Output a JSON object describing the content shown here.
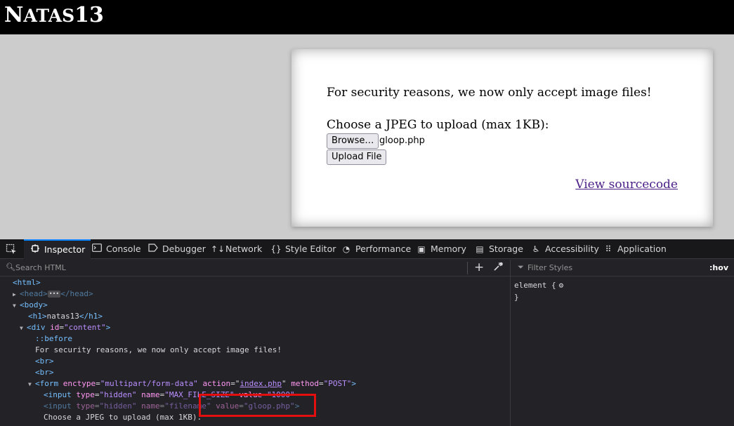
{
  "header": {
    "title_first": "N",
    "title_small": "ATAS",
    "title_number": "13"
  },
  "card": {
    "notice": "For security reasons, we now only accept image files!",
    "choose_label": "Choose a JPEG to upload (max 1KB):",
    "browse_button": "Browse…",
    "selected_file": "gloop.php",
    "upload_button": "Upload File",
    "source_link": "View sourcecode"
  },
  "devtools": {
    "tabs": [
      {
        "label": "Inspector",
        "icon": "inspector-icon"
      },
      {
        "label": "Console",
        "icon": "console-icon"
      },
      {
        "label": "Debugger",
        "icon": "debugger-icon"
      },
      {
        "label": "Network",
        "icon": "network-icon"
      },
      {
        "label": "Style Editor",
        "icon": "style-editor-icon"
      },
      {
        "label": "Performance",
        "icon": "performance-icon"
      },
      {
        "label": "Memory",
        "icon": "memory-icon"
      },
      {
        "label": "Storage",
        "icon": "storage-icon"
      },
      {
        "label": "Accessibility",
        "icon": "accessibility-icon"
      },
      {
        "label": "Application",
        "icon": "application-icon"
      }
    ],
    "search_placeholder": "Search HTML",
    "filter_placeholder": "Filter Styles",
    "hov_label": ":hov",
    "rule_selector": "element {",
    "rule_close": "}",
    "tree": {
      "html": "<html>",
      "head_open": "<head>",
      "head_close": "</head>",
      "body": "<body>",
      "h1_open": "<h1>",
      "h1_text": "natas13",
      "h1_close": "</h1>",
      "div_open": "<div ",
      "div_attr_name": "id",
      "div_attr_value": "\"content\"",
      "div_end": ">",
      "before": "::before",
      "notice_text": "For security reasons, we now only accept image files!",
      "br1": "<br>",
      "br2": "<br>",
      "form_open": "<form ",
      "form_enctype_name": "enctype",
      "form_enctype_value": "\"multipart/form-data\"",
      "form_action_name": "action",
      "form_action_value": "index.php",
      "form_method_name": "method",
      "form_method_value": "\"POST\"",
      "form_end": ">",
      "input1_open": "<input ",
      "input1_type_name": "type",
      "input1_type_value": "\"hidden\"",
      "input1_name_name": "name",
      "input1_name_value": "\"MAX_FILE_SIZE\"",
      "input1_value_name": "value",
      "input1_value_value": "\"1000\"",
      "input2_open": "<input ",
      "input2_type_name": "type",
      "input2_type_value": "\"hidden\"",
      "input2_name_name": "name",
      "input2_name_value": "\"filename\"",
      "input2_value_name": "value",
      "input2_value_value": "\"gloop.php\"",
      "input2_end": ">",
      "choose_text": "Choose a JPEG to upload (max 1KB):"
    }
  },
  "colors": {
    "highlight_box": "#e30e0e",
    "active_tab_accent": "#0a84ff"
  }
}
